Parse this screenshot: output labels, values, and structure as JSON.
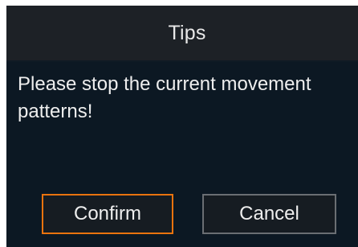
{
  "dialog": {
    "title": "Tips",
    "message": "Please stop the current movement patterns!",
    "confirm_label": "Confirm",
    "cancel_label": "Cancel"
  },
  "colors": {
    "background": "#0b1620",
    "titlebar": "#1d2126",
    "confirm_border": "#e9730e",
    "cancel_border": "#6a6e73",
    "text": "#eeeeee"
  }
}
